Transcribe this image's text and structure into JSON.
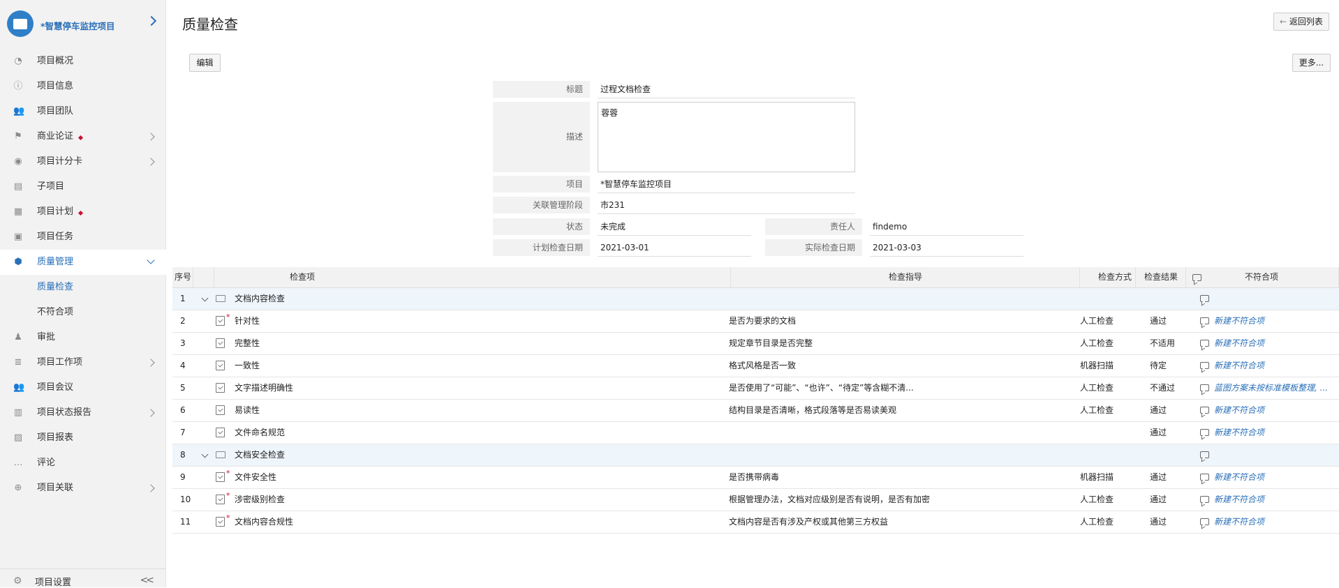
{
  "project": {
    "name": "*智慧停车监控项目"
  },
  "nav": {
    "items": [
      {
        "label": "项目概况",
        "icon": "pie-chart-icon"
      },
      {
        "label": "项目信息",
        "icon": "info-icon"
      },
      {
        "label": "项目团队",
        "icon": "team-icon"
      },
      {
        "label": "商业论证",
        "icon": "flag-icon",
        "dot": true,
        "arrow": true
      },
      {
        "label": "项目计分卡",
        "icon": "target-icon",
        "arrow": true
      },
      {
        "label": "子项目",
        "icon": "subproject-icon"
      },
      {
        "label": "项目计划",
        "icon": "plan-icon",
        "dot": true
      },
      {
        "label": "项目任务",
        "icon": "task-icon"
      },
      {
        "label": "质量管理",
        "icon": "shield-icon",
        "active": true,
        "expanded": true
      },
      {
        "label": "审批",
        "icon": "approval-icon"
      },
      {
        "label": "项目工作项",
        "icon": "workitem-icon",
        "arrow": true
      },
      {
        "label": "项目会议",
        "icon": "meeting-icon"
      },
      {
        "label": "项目状态报告",
        "icon": "status-report-icon",
        "arrow": true
      },
      {
        "label": "项目报表",
        "icon": "report-icon"
      },
      {
        "label": "评论",
        "icon": "comment-icon"
      },
      {
        "label": "项目关联",
        "icon": "link-icon",
        "arrow": true
      }
    ],
    "sub_items": [
      {
        "label": "质量检查",
        "active": true
      },
      {
        "label": "不符合项",
        "active": false
      }
    ],
    "settings_label": "项目设置"
  },
  "header": {
    "title": "质量检查",
    "back_label": "返回列表",
    "edit_label": "编辑",
    "more_label": "更多..."
  },
  "form": {
    "title_label": "标题",
    "title_value": "过程文档检查",
    "desc_label": "描述",
    "desc_value": "蓉蓉",
    "project_label": "项目",
    "project_value": "*智慧停车监控项目",
    "stage_label": "关联管理阶段",
    "stage_value": "市231",
    "status_label": "状态",
    "status_value": "未完成",
    "owner_label": "责任人",
    "owner_value": "findemo",
    "plan_date_label": "计划检查日期",
    "plan_date_value": "2021-03-01",
    "actual_date_label": "实际检查日期",
    "actual_date_value": "2021-03-03"
  },
  "table": {
    "columns": {
      "no": "序号",
      "item": "检查项",
      "guide": "检查指导",
      "method": "检查方式",
      "result": "检查结果",
      "nc": "不符合项"
    },
    "rows": [
      {
        "no": "1",
        "type": "group",
        "item": "文档内容检查",
        "guide": "",
        "method": "",
        "result": "",
        "nc": ""
      },
      {
        "no": "2",
        "type": "item",
        "required": true,
        "item": "针对性",
        "guide": "是否为要求的文档",
        "method": "人工检查",
        "result": "通过",
        "nc": "新建不符合项"
      },
      {
        "no": "3",
        "type": "item",
        "required": false,
        "item": "完整性",
        "guide": "规定章节目录是否完整",
        "method": "人工检查",
        "result": "不适用",
        "nc": "新建不符合项"
      },
      {
        "no": "4",
        "type": "item",
        "required": false,
        "item": "一致性",
        "guide": "格式风格是否一致",
        "method": "机器扫描",
        "result": "待定",
        "nc": "新建不符合项"
      },
      {
        "no": "5",
        "type": "item",
        "required": false,
        "item": "文字描述明确性",
        "guide": "是否使用了“可能”、“也许”、“待定”等含糊不清...",
        "method": "人工检查",
        "result": "不通过",
        "nc": "蓝图方案未按标准模板整理, ..."
      },
      {
        "no": "6",
        "type": "item",
        "required": false,
        "item": "易读性",
        "guide": "结构目录是否清晰，格式段落等是否易读美观",
        "method": "人工检查",
        "result": "通过",
        "nc": "新建不符合项"
      },
      {
        "no": "7",
        "type": "item",
        "required": false,
        "item": "文件命名规范",
        "guide": "",
        "method": "",
        "result": "通过",
        "nc": "新建不符合项"
      },
      {
        "no": "8",
        "type": "group",
        "item": "文档安全检查",
        "guide": "",
        "method": "",
        "result": "",
        "nc": ""
      },
      {
        "no": "9",
        "type": "item",
        "required": true,
        "item": "文件安全性",
        "guide": "是否携带病毒",
        "method": "机器扫描",
        "result": "通过",
        "nc": "新建不符合项"
      },
      {
        "no": "10",
        "type": "item",
        "required": true,
        "item": "涉密级别检查",
        "guide": "根据管理办法，文档对应级别是否有说明，是否有加密",
        "method": "人工检查",
        "result": "通过",
        "nc": "新建不符合项"
      },
      {
        "no": "11",
        "type": "item",
        "required": true,
        "item": "文档内容合规性",
        "guide": "文档内容是否有涉及产权或其他第三方权益",
        "method": "人工检查",
        "result": "通过",
        "nc": "新建不符合项"
      }
    ]
  },
  "colors": {
    "accent": "#2a6fb8",
    "required": "#c8102e",
    "group_row": "#eef5fb"
  }
}
